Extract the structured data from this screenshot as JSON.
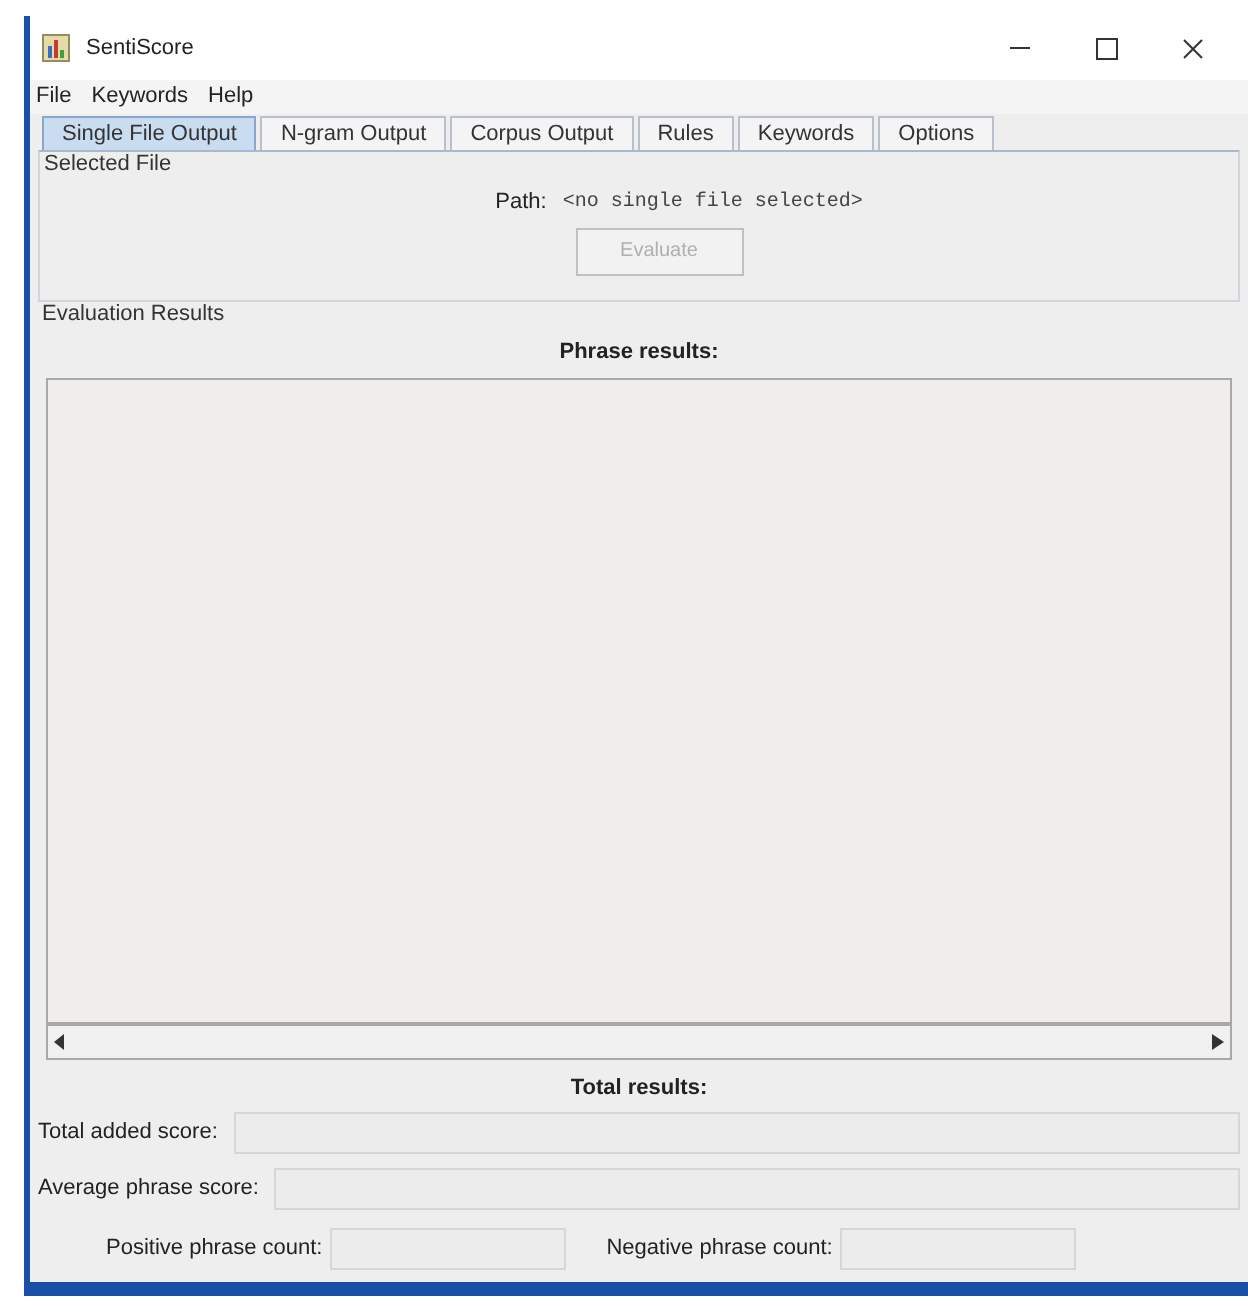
{
  "window": {
    "title": "SentiScore"
  },
  "menu": [
    "File",
    "Keywords",
    "Help"
  ],
  "tabs": [
    {
      "label": "Single File Output",
      "selected": true
    },
    {
      "label": "N-gram Output",
      "selected": false
    },
    {
      "label": "Corpus Output",
      "selected": false
    },
    {
      "label": "Rules",
      "selected": false
    },
    {
      "label": "Keywords",
      "selected": false
    },
    {
      "label": "Options",
      "selected": false
    }
  ],
  "selected_file": {
    "title": "Selected File",
    "path_label": "Path:",
    "path_value": "<no single file selected>",
    "button": {
      "label": "Evaluate",
      "disabled": true
    }
  },
  "evaluation_results": {
    "title": "Evaluation Results",
    "phrase_results_label": "Phrase results:",
    "total_results_label": "Total results:",
    "total_added_score": {
      "label": "Total added score:"
    },
    "average_phrase_score": {
      "label": "Average phrase score:"
    },
    "positive_phrase_count": {
      "label": "Positive phrase count:"
    },
    "negative_phrase_count": {
      "label": "Negative phrase count:"
    }
  }
}
